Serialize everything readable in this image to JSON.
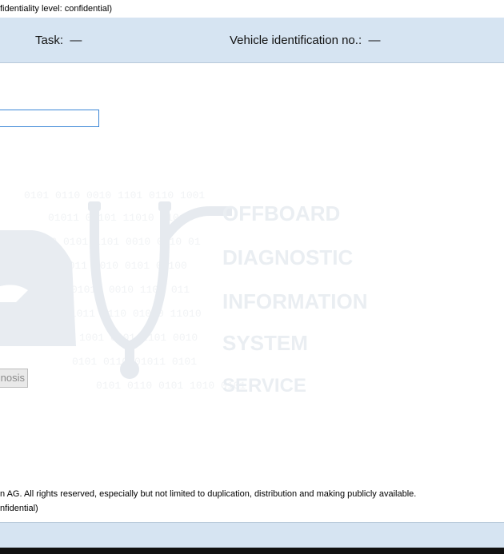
{
  "top_note": "fidentiality level: confidential)",
  "header": {
    "task_label": "Task:",
    "task_value": "—",
    "vin_label": "Vehicle identification no.:",
    "vin_value": "—"
  },
  "input": {
    "value": ""
  },
  "logo": {
    "lines": [
      "OFFBOARD",
      "DIAGNOSTIC",
      "INFORMATION",
      "SYSTEM",
      "SERVICE"
    ],
    "icon": "car-stethoscope-icon"
  },
  "button": {
    "label": "nosis"
  },
  "footer": {
    "copyright": "n AG. All rights reserved, especially but not limited to duplication, distribution and making publicly available.",
    "confidential": "nfidential)"
  },
  "colors": {
    "header_bg": "#d6e4f2",
    "input_border": "#3b86d6"
  }
}
